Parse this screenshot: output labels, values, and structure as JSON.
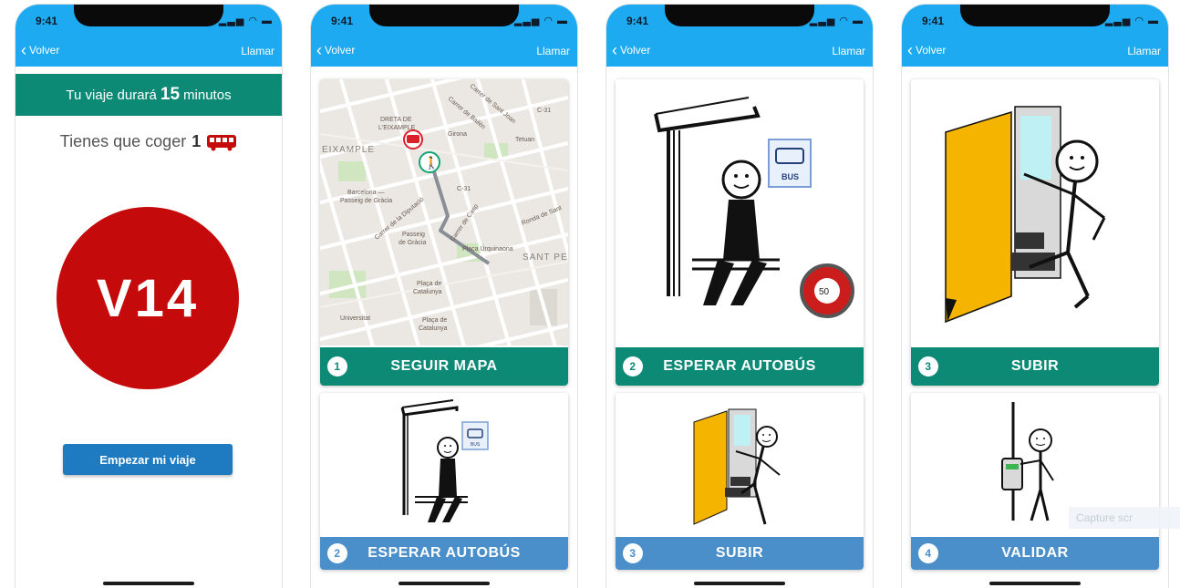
{
  "status": {
    "time": "9:41"
  },
  "nav": {
    "back_label": "Volver",
    "call_label": "Llamar"
  },
  "trip": {
    "duration_prefix": "Tu viaje durará",
    "duration_value": "15",
    "duration_unit": "minutos",
    "take_prefix": "Tienes que coger",
    "take_count": "1",
    "line_code": "V14",
    "start_button": "Empezar mi viaje"
  },
  "map": {
    "labels": [
      "DRETA DE",
      "L'EIXAMPLE",
      "EIXAMPLE",
      "Girona",
      "Tetuan",
      "C-31",
      "C-31",
      "Barcelona —",
      "Passeig de Gràcia",
      "Passeig",
      "de Gràcia",
      "Plaça Urquinaona",
      "SANT PE",
      "Plaça de",
      "Catalunya",
      "Universitat",
      "Plaça de",
      "Catalunya",
      "Carrer de Bailèn",
      "Carrer de Sant Joan",
      "Ronda de Sant",
      "Carrer de Casp",
      "Carrer de la Diputació"
    ],
    "clock_value": "50"
  },
  "screens": [
    {
      "big": {
        "number": "1",
        "label": "SEGUIR MAPA"
      },
      "small": {
        "number": "2",
        "label": "ESPERAR AUTOBÚS"
      }
    },
    {
      "big": {
        "number": "2",
        "label": "ESPERAR AUTOBÚS"
      },
      "small": {
        "number": "3",
        "label": "SUBIR"
      }
    },
    {
      "big": {
        "number": "3",
        "label": "SUBIR"
      },
      "small": {
        "number": "4",
        "label": "VALIDAR"
      }
    }
  ],
  "bus_sign": "BUS",
  "overlay_text": "Capture scr",
  "colors": {
    "header_blue": "#1eaaf1",
    "teal": "#0d8a76",
    "step_blue": "#4a8fc9",
    "line_red": "#c40a0a",
    "button_blue": "#1e7bc2",
    "door_yellow": "#f5b400"
  }
}
